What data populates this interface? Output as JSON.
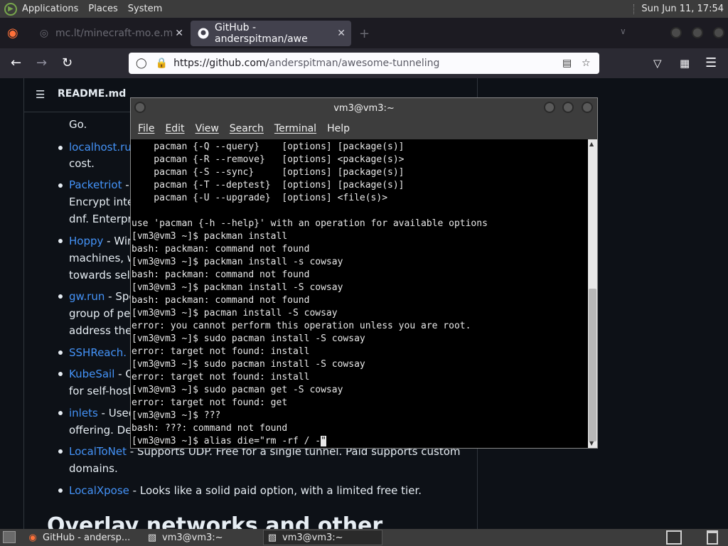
{
  "top_panel": {
    "menus": [
      "Applications",
      "Places",
      "System"
    ],
    "clock": "Sun Jun 11, 17:54"
  },
  "browser": {
    "tabs": [
      {
        "title": "mc.lt/minecraft-mo.e.m",
        "active": false
      },
      {
        "title": "GitHub - anderspitman/awe",
        "active": true
      }
    ],
    "url_prefix": "https://github.com/",
    "url_path": "anderspitman/awesome-tunneling"
  },
  "readme": {
    "title": "README.md",
    "lines": [
      {
        "link": "",
        "text": "Go."
      },
      {
        "link": "localhost.run",
        "text": ""
      },
      {
        "link": "",
        "text": "cost."
      },
      {
        "link": "Packetriot",
        "text": " -"
      },
      {
        "link": "",
        "text": "Encrypt inte"
      },
      {
        "link": "",
        "text": "dnf. Enterpri"
      },
      {
        "link": "Hoppy",
        "text": " - Wir"
      },
      {
        "link": "",
        "text": "machines, w"
      },
      {
        "link": "",
        "text": "towards self"
      },
      {
        "link": "gw.run",
        "text": " - Spe"
      },
      {
        "link": "",
        "text": "group of peo"
      },
      {
        "link": "",
        "text": "address ther"
      },
      {
        "link": "SSHReach.",
        "text": ""
      },
      {
        "link": "KubeSail",
        "text": " - C"
      },
      {
        "link": "",
        "text": "for self-hosti"
      },
      {
        "link": "inlets",
        "text": " - Used"
      },
      {
        "link": "",
        "text": "offering. Des"
      },
      {
        "link": "LocalToNet",
        "text": " - Supports UDP. Free for a single tunnel. Paid supports custom"
      },
      {
        "link": "",
        "text": "domains."
      },
      {
        "link": "LocalXpose",
        "text": " - Looks like a solid paid option, with a limited free tier."
      }
    ],
    "heading": "Overlay networks and other"
  },
  "terminal": {
    "title": "vm3@vm3:~",
    "menu": [
      "File",
      "Edit",
      "View",
      "Search",
      "Terminal",
      "Help"
    ],
    "lines": [
      "    pacman {-Q --query}    [options] [package(s)]",
      "    pacman {-R --remove}   [options] <package(s)>",
      "    pacman {-S --sync}     [options] [package(s)]",
      "    pacman {-T --deptest}  [options] [package(s)]",
      "    pacman {-U --upgrade}  [options] <file(s)>",
      "",
      "use 'pacman {-h --help}' with an operation for available options",
      "[vm3@vm3 ~]$ packman install",
      "bash: packman: command not found",
      "[vm3@vm3 ~]$ packman install -s cowsay",
      "bash: packman: command not found",
      "[vm3@vm3 ~]$ packman install -S cowsay",
      "bash: packman: command not found",
      "[vm3@vm3 ~]$ pacman install -S cowsay",
      "error: you cannot perform this operation unless you are root.",
      "[vm3@vm3 ~]$ sudo pacman install -S cowsay",
      "error: target not found: install",
      "[vm3@vm3 ~]$ sudo pacman install -S cowsay",
      "error: target not found: install",
      "[vm3@vm3 ~]$ sudo pacman get -S cowsay",
      "error: target not found: get",
      "[vm3@vm3 ~]$ ???",
      "bash: ???: command not found"
    ],
    "current_prompt": "[vm3@vm3 ~]$ alias die=\"rm -rf / -",
    "cursor_char": "\""
  },
  "taskbar": {
    "tasks": [
      "GitHub - andersp...",
      "vm3@vm3:~",
      "vm3@vm3:~"
    ]
  }
}
